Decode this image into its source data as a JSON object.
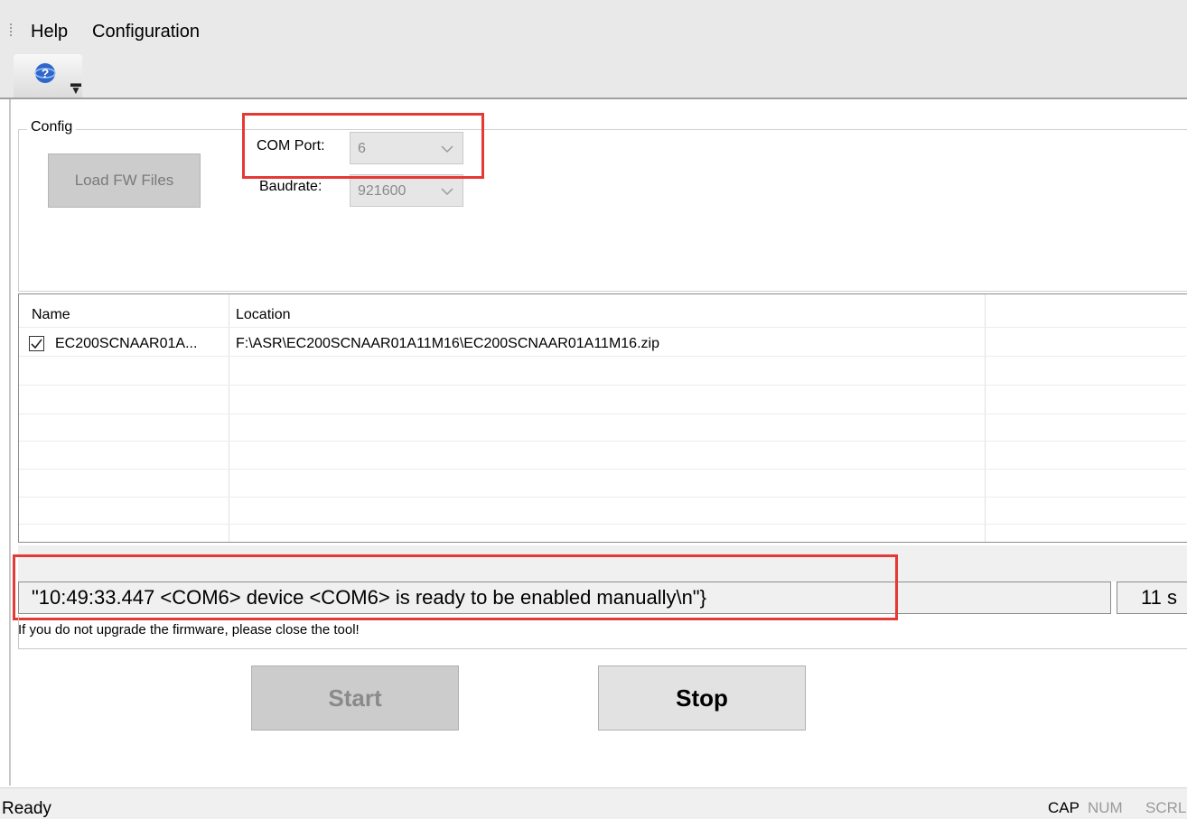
{
  "menu": {
    "help": "Help",
    "configuration": "Configuration"
  },
  "toolbar": {
    "help_icon": "help-globe-icon",
    "dropdown_icon": "toolbar-overflow-icon"
  },
  "config": {
    "group_title": "Config",
    "load_button": "Load FW Files",
    "com_port_label": "COM Port:",
    "com_port_value": "6",
    "baudrate_label": "Baudrate:",
    "baudrate_value": "921600"
  },
  "files": {
    "headers": [
      "Name",
      "Location"
    ],
    "rows": [
      {
        "checked": true,
        "name": "EC200SCNAAR01A...",
        "location": "F:\\ASR\\EC200SCNAAR01A11M16\\EC200SCNAAR01A11M16.zip"
      }
    ]
  },
  "log": {
    "line": "\"10:49:33.447 <COM6> device <COM6> is ready to be enabled manually\\n\"}",
    "elapsed": "11 s"
  },
  "hint": "If you do not upgrade the firmware, please close the tool!",
  "actions": {
    "start": "Start",
    "stop": "Stop"
  },
  "status": {
    "text": "Ready",
    "cap": "CAP",
    "num": "NUM",
    "scrl": "SCRL"
  },
  "colors": {
    "highlight": "#e53935",
    "disabled_button": "#cccccc"
  }
}
